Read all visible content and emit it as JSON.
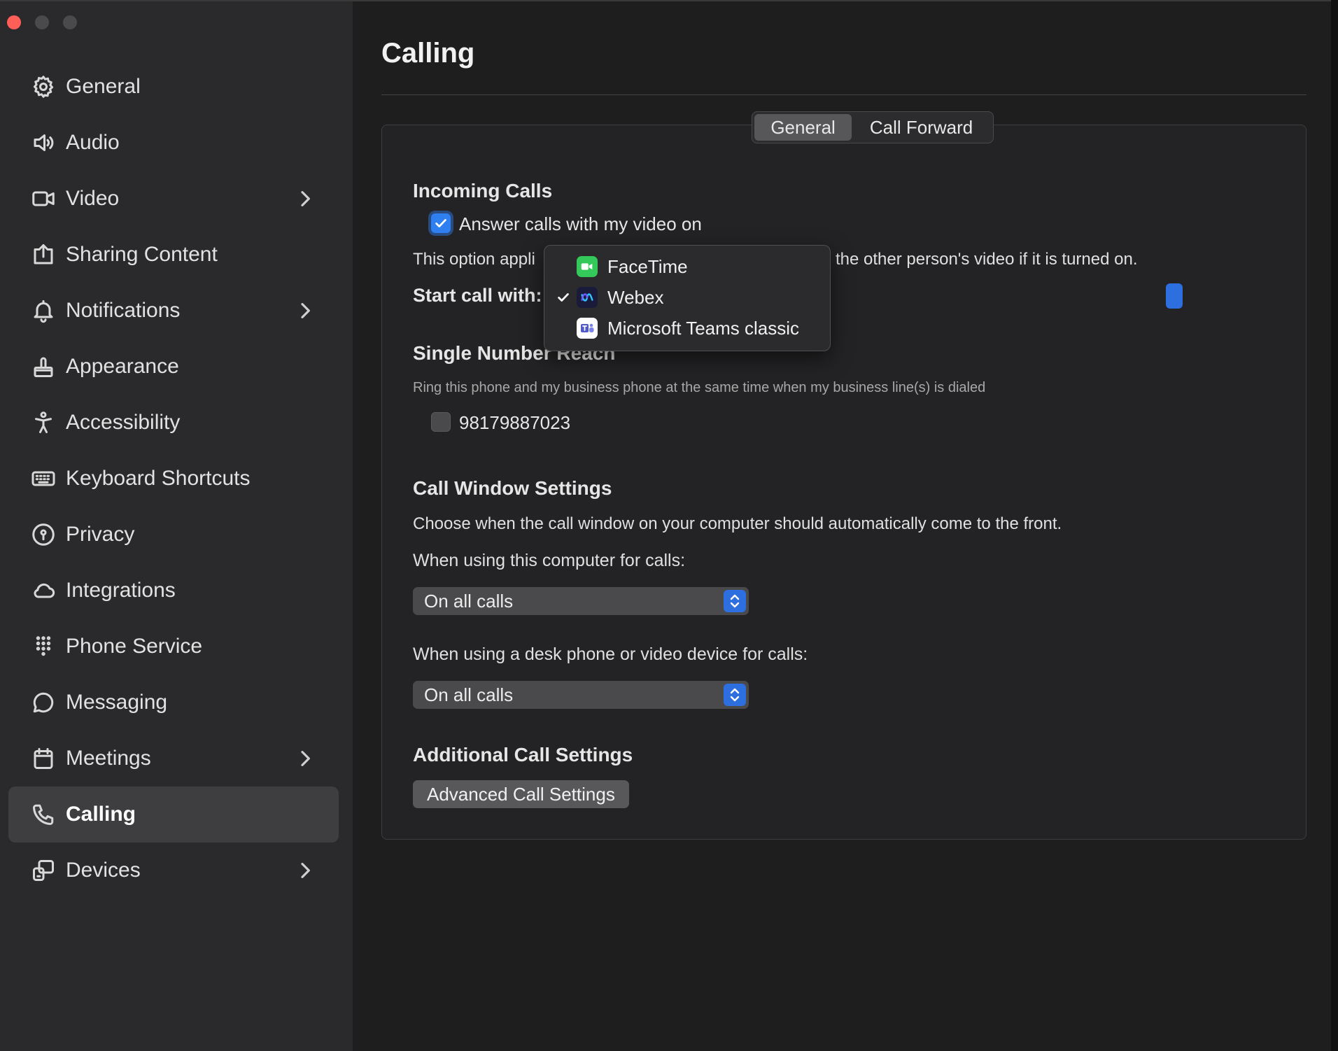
{
  "sidebar": {
    "items": [
      {
        "label": "General",
        "icon": "gear-icon",
        "chevron": false,
        "active": false
      },
      {
        "label": "Audio",
        "icon": "speaker-icon",
        "chevron": false,
        "active": false
      },
      {
        "label": "Video",
        "icon": "video-camera-icon",
        "chevron": true,
        "active": false
      },
      {
        "label": "Sharing Content",
        "icon": "share-screen-icon",
        "chevron": false,
        "active": false
      },
      {
        "label": "Notifications",
        "icon": "bell-icon",
        "chevron": true,
        "active": false
      },
      {
        "label": "Appearance",
        "icon": "paint-brush-icon",
        "chevron": false,
        "active": false
      },
      {
        "label": "Accessibility",
        "icon": "accessibility-icon",
        "chevron": false,
        "active": false
      },
      {
        "label": "Keyboard Shortcuts",
        "icon": "keyboard-icon",
        "chevron": false,
        "active": false
      },
      {
        "label": "Privacy",
        "icon": "lock-circle-icon",
        "chevron": false,
        "active": false
      },
      {
        "label": "Integrations",
        "icon": "cloud-icon",
        "chevron": false,
        "active": false
      },
      {
        "label": "Phone Service",
        "icon": "dialpad-icon",
        "chevron": false,
        "active": false
      },
      {
        "label": "Messaging",
        "icon": "chat-bubble-icon",
        "chevron": false,
        "active": false
      },
      {
        "label": "Meetings",
        "icon": "calendar-icon",
        "chevron": true,
        "active": false
      },
      {
        "label": "Calling",
        "icon": "phone-icon",
        "chevron": false,
        "active": true
      },
      {
        "label": "Devices",
        "icon": "devices-icon",
        "chevron": true,
        "active": false
      }
    ]
  },
  "page": {
    "title": "Calling"
  },
  "tabs": {
    "general": "General",
    "call_forward": "Call Forward"
  },
  "incoming": {
    "heading": "Incoming Calls",
    "answer_video_label": "Answer calls with my video on",
    "answer_video_checked": true,
    "note_left": "This option appli",
    "note_right": "the other person's video if it is turned on.",
    "start_call_label": "Start call with:"
  },
  "menu": {
    "items": [
      {
        "label": "FaceTime",
        "icon": "facetime-icon",
        "checked": false
      },
      {
        "label": "Webex",
        "icon": "webex-icon",
        "checked": true
      },
      {
        "label": "Microsoft Teams classic",
        "icon": "teams-icon",
        "checked": false
      }
    ]
  },
  "single_number": {
    "heading": "Single Number Reach",
    "description": "Ring this phone and my business phone at the same time when my business line(s) is dialed",
    "phone_label": "98179887023",
    "phone_checked": false
  },
  "call_window": {
    "heading": "Call Window Settings",
    "description": "Choose when the call window on your computer should automatically come to the front.",
    "computer_label": "When using this computer for calls:",
    "computer_value": "On all calls",
    "desk_label": "When using a desk phone or video device for calls:",
    "desk_value": "On all calls"
  },
  "additional": {
    "heading": "Additional Call Settings",
    "button": "Advanced Call Settings"
  },
  "colors": {
    "accent": "#2f7ff0",
    "close": "#ff5f57"
  }
}
